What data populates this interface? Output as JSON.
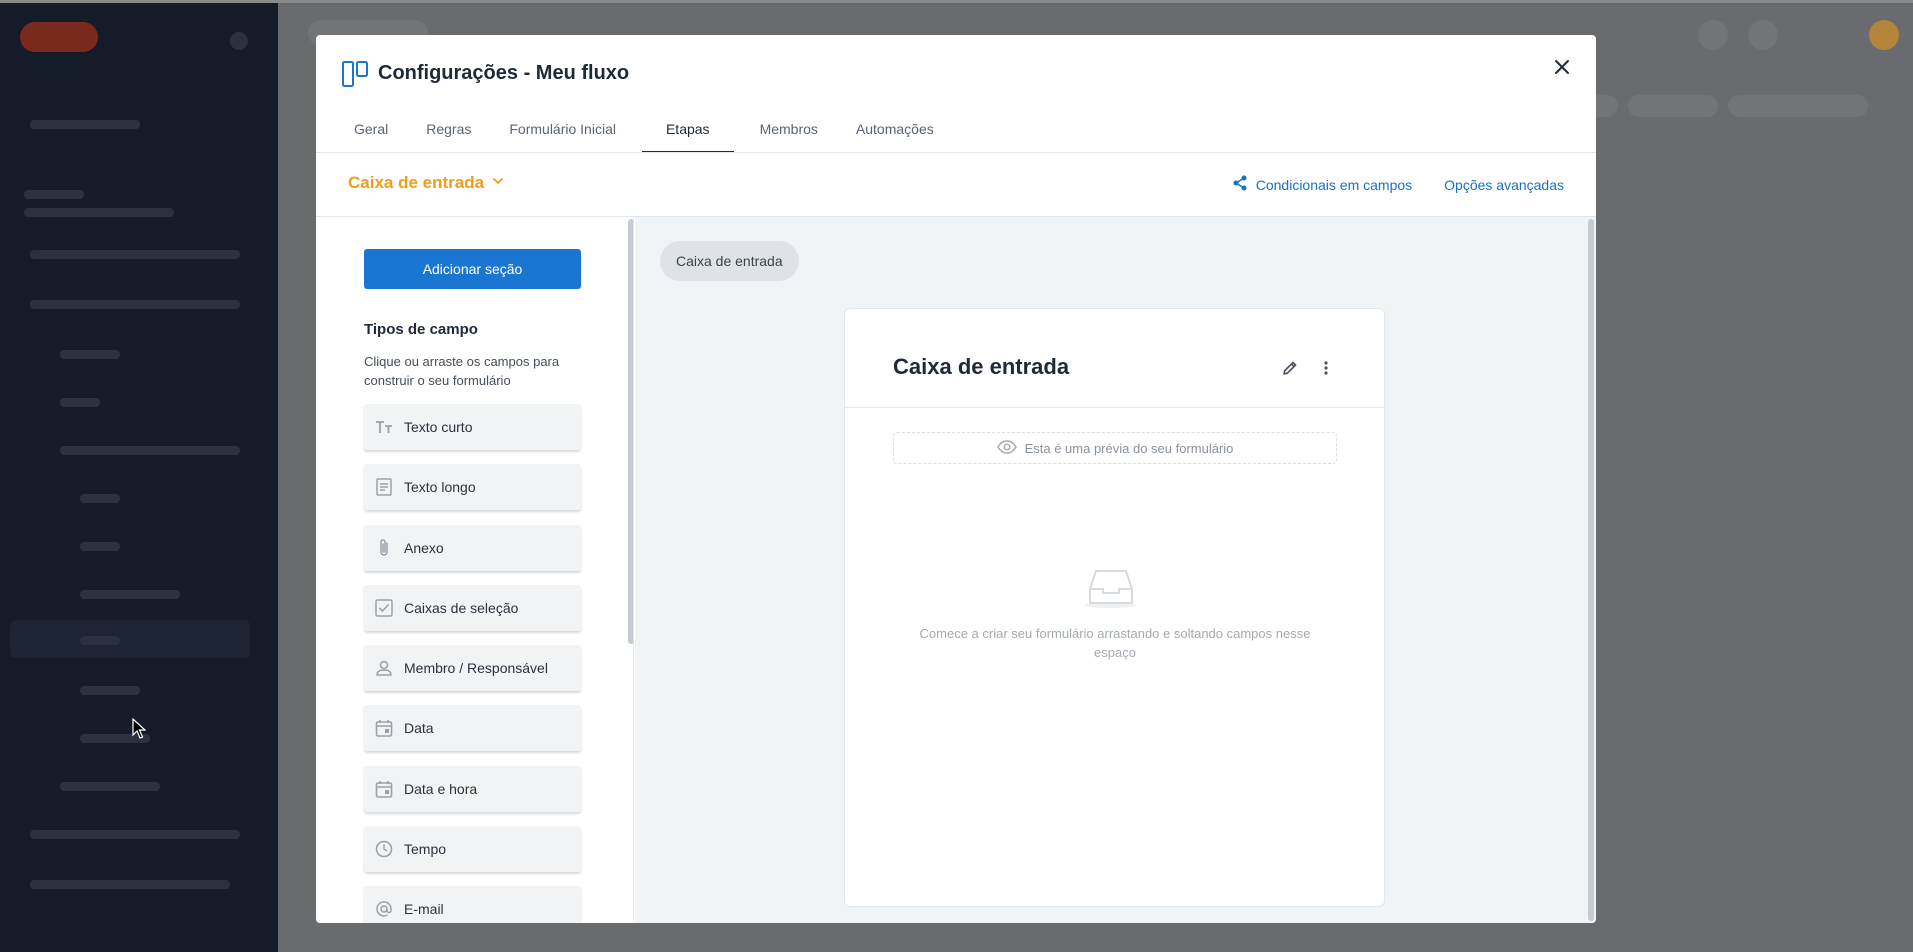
{
  "modal": {
    "title": "Configurações - Meu fluxo",
    "tabs": [
      {
        "label": "Geral",
        "active": false
      },
      {
        "label": "Regras",
        "active": false
      },
      {
        "label": "Formulário Inicial",
        "active": false
      },
      {
        "label": "Etapas",
        "active": true
      },
      {
        "label": "Membros",
        "active": false
      },
      {
        "label": "Automações",
        "active": false
      }
    ],
    "phase_selector": {
      "label": "Caixa de entrada",
      "color": "#f39c19"
    },
    "actions": {
      "conditionals": "Condicionais em campos",
      "advanced": "Opções avançadas"
    }
  },
  "left_panel": {
    "add_section_label": "Adicionar seção",
    "types_title": "Tipos de campo",
    "types_description": "Clique ou arraste os campos para construir o seu formulário",
    "field_types": [
      {
        "label": "Texto curto",
        "icon": "text-short-icon"
      },
      {
        "label": "Texto longo",
        "icon": "text-long-icon"
      },
      {
        "label": "Anexo",
        "icon": "attachment-icon"
      },
      {
        "label": "Caixas de seleção",
        "icon": "checkbox-icon"
      },
      {
        "label": "Membro / Responsável",
        "icon": "person-icon"
      },
      {
        "label": "Data",
        "icon": "calendar-icon"
      },
      {
        "label": "Data e hora",
        "icon": "calendar-icon"
      },
      {
        "label": "Tempo",
        "icon": "clock-icon"
      },
      {
        "label": "E-mail",
        "icon": "at-icon"
      }
    ]
  },
  "canvas": {
    "phase_pill": "Caixa de entrada",
    "form_title": "Caixa de entrada",
    "preview_notice": "Esta é uma prévia do seu formulário",
    "empty_message": "Comece a criar seu formulário arrastando e soltando campos nesse espaço"
  },
  "colors": {
    "primary": "#1b76d1",
    "accent": "#f39c19",
    "link": "#1672c7"
  }
}
